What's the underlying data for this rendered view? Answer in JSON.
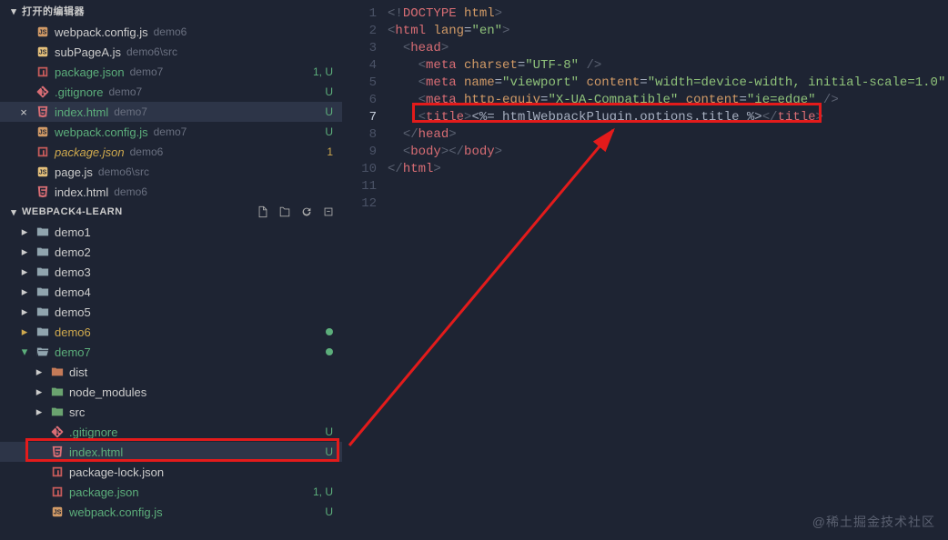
{
  "openEditors": {
    "title": "打开的编辑器",
    "items": [
      {
        "icon": "js-orange",
        "name": "webpack.config.js",
        "sub": "demo6",
        "status": "",
        "cls": ""
      },
      {
        "icon": "js-yellow",
        "name": "subPageA.js",
        "sub": "demo6\\src",
        "status": "",
        "cls": ""
      },
      {
        "icon": "npm",
        "name": "package.json",
        "sub": "demo7",
        "status": "1, U",
        "cls": "unt"
      },
      {
        "icon": "git",
        "name": ".gitignore",
        "sub": "demo7",
        "status": "U",
        "cls": "unt"
      },
      {
        "icon": "html",
        "name": "index.html",
        "sub": "demo7",
        "status": "U",
        "cls": "unt",
        "active": true,
        "close": true
      },
      {
        "icon": "js-orange",
        "name": "webpack.config.js",
        "sub": "demo7",
        "status": "U",
        "cls": "unt"
      },
      {
        "icon": "npm",
        "name": "package.json",
        "sub": "demo6",
        "status": "1",
        "cls": "mod",
        "italic": true
      },
      {
        "icon": "js-yellow",
        "name": "page.js",
        "sub": "demo6\\src",
        "status": "",
        "cls": ""
      },
      {
        "icon": "html",
        "name": "index.html",
        "sub": "demo6",
        "status": "",
        "cls": ""
      }
    ]
  },
  "explorer": {
    "title": "WEBPACK4-LEARN",
    "actions": [
      "new-file",
      "new-folder",
      "refresh",
      "collapse"
    ],
    "tree": [
      {
        "type": "folder",
        "name": "demo1",
        "depth": 0,
        "open": false
      },
      {
        "type": "folder",
        "name": "demo2",
        "depth": 0,
        "open": false
      },
      {
        "type": "folder",
        "name": "demo3",
        "depth": 0,
        "open": false
      },
      {
        "type": "folder",
        "name": "demo4",
        "depth": 0,
        "open": false
      },
      {
        "type": "folder",
        "name": "demo5",
        "depth": 0,
        "open": false
      },
      {
        "type": "folder",
        "name": "demo6",
        "depth": 0,
        "open": false,
        "cls": "mod",
        "dot": true
      },
      {
        "type": "folder",
        "name": "demo7",
        "depth": 0,
        "open": true,
        "cls": "unt",
        "dot": true
      },
      {
        "type": "folder",
        "name": "dist",
        "depth": 1,
        "open": false,
        "color": "#c47a58"
      },
      {
        "type": "folder",
        "name": "node_modules",
        "depth": 1,
        "open": false,
        "color": "#6aa36f"
      },
      {
        "type": "folder",
        "name": "src",
        "depth": 1,
        "open": false,
        "color": "#6aa36f"
      },
      {
        "type": "file",
        "icon": "git",
        "name": ".gitignore",
        "depth": 1,
        "status": "U",
        "cls": "unt"
      },
      {
        "type": "file",
        "icon": "html",
        "name": "index.html",
        "depth": 1,
        "status": "U",
        "cls": "unt",
        "active": true,
        "boxed": true
      },
      {
        "type": "file",
        "icon": "npm",
        "name": "package-lock.json",
        "depth": 1,
        "status": "",
        "cls": ""
      },
      {
        "type": "file",
        "icon": "npm",
        "name": "package.json",
        "depth": 1,
        "status": "1, U",
        "cls": "unt"
      },
      {
        "type": "file",
        "icon": "js-orange",
        "name": "webpack.config.js",
        "depth": 1,
        "status": "U",
        "cls": "unt"
      }
    ]
  },
  "code": {
    "lines": [
      [
        [
          "<!",
          "t-gray"
        ],
        [
          "DOCTYPE",
          "t-red"
        ],
        [
          " ",
          "t-default"
        ],
        [
          "html",
          "t-orange"
        ],
        [
          ">",
          "t-gray"
        ]
      ],
      [
        [
          "<",
          "t-gray"
        ],
        [
          "html",
          "t-red"
        ],
        [
          " ",
          "t-default"
        ],
        [
          "lang",
          "t-orange"
        ],
        [
          "=",
          "t-default"
        ],
        [
          "\"en\"",
          "t-green"
        ],
        [
          ">",
          "t-gray"
        ]
      ],
      [
        [
          "  ",
          "t-default"
        ],
        [
          "<",
          "t-gray"
        ],
        [
          "head",
          "t-red"
        ],
        [
          ">",
          "t-gray"
        ]
      ],
      [
        [
          "    ",
          "t-default"
        ],
        [
          "<",
          "t-gray"
        ],
        [
          "meta",
          "t-red"
        ],
        [
          " ",
          "t-default"
        ],
        [
          "charset",
          "t-orange"
        ],
        [
          "=",
          "t-default"
        ],
        [
          "\"UTF-8\"",
          "t-green"
        ],
        [
          " />",
          "t-gray"
        ]
      ],
      [
        [
          "    ",
          "t-default"
        ],
        [
          "<",
          "t-gray"
        ],
        [
          "meta",
          "t-red"
        ],
        [
          " ",
          "t-default"
        ],
        [
          "name",
          "t-orange"
        ],
        [
          "=",
          "t-default"
        ],
        [
          "\"viewport\"",
          "t-green"
        ],
        [
          " ",
          "t-default"
        ],
        [
          "content",
          "t-orange"
        ],
        [
          "=",
          "t-default"
        ],
        [
          "\"width=device-width, initial-scale=1.0\"",
          "t-green"
        ],
        [
          " />",
          "t-gray"
        ]
      ],
      [
        [
          "    ",
          "t-default"
        ],
        [
          "<",
          "t-gray"
        ],
        [
          "meta",
          "t-red"
        ],
        [
          " ",
          "t-default"
        ],
        [
          "http-equiv",
          "t-orange"
        ],
        [
          "=",
          "t-default"
        ],
        [
          "\"X-UA-Compatible\"",
          "t-green"
        ],
        [
          " ",
          "t-default"
        ],
        [
          "content",
          "t-orange"
        ],
        [
          "=",
          "t-default"
        ],
        [
          "\"ie=edge\"",
          "t-green"
        ],
        [
          " />",
          "t-gray"
        ]
      ],
      [
        [
          "    ",
          "t-default"
        ],
        [
          "<",
          "t-gray"
        ],
        [
          "title",
          "t-red"
        ],
        [
          ">",
          "t-gray"
        ],
        [
          "<%= htmlWebpackPlugin.options.title %>",
          "t-default"
        ],
        [
          "</",
          "t-gray"
        ],
        [
          "title",
          "t-red"
        ],
        [
          ">",
          "t-gray"
        ]
      ],
      [
        [
          "  ",
          "t-default"
        ],
        [
          "</",
          "t-gray"
        ],
        [
          "head",
          "t-red"
        ],
        [
          ">",
          "t-gray"
        ]
      ],
      [
        [
          "",
          "t-default"
        ]
      ],
      [
        [
          "  ",
          "t-default"
        ],
        [
          "<",
          "t-gray"
        ],
        [
          "body",
          "t-red"
        ],
        [
          "></",
          "t-gray"
        ],
        [
          "body",
          "t-red"
        ],
        [
          ">",
          "t-gray"
        ]
      ],
      [
        [
          "</",
          "t-gray"
        ],
        [
          "html",
          "t-red"
        ],
        [
          ">",
          "t-gray"
        ]
      ],
      [
        [
          "",
          "t-default"
        ]
      ]
    ],
    "currentLine": 7
  },
  "watermark": "@稀土掘金技术社区"
}
